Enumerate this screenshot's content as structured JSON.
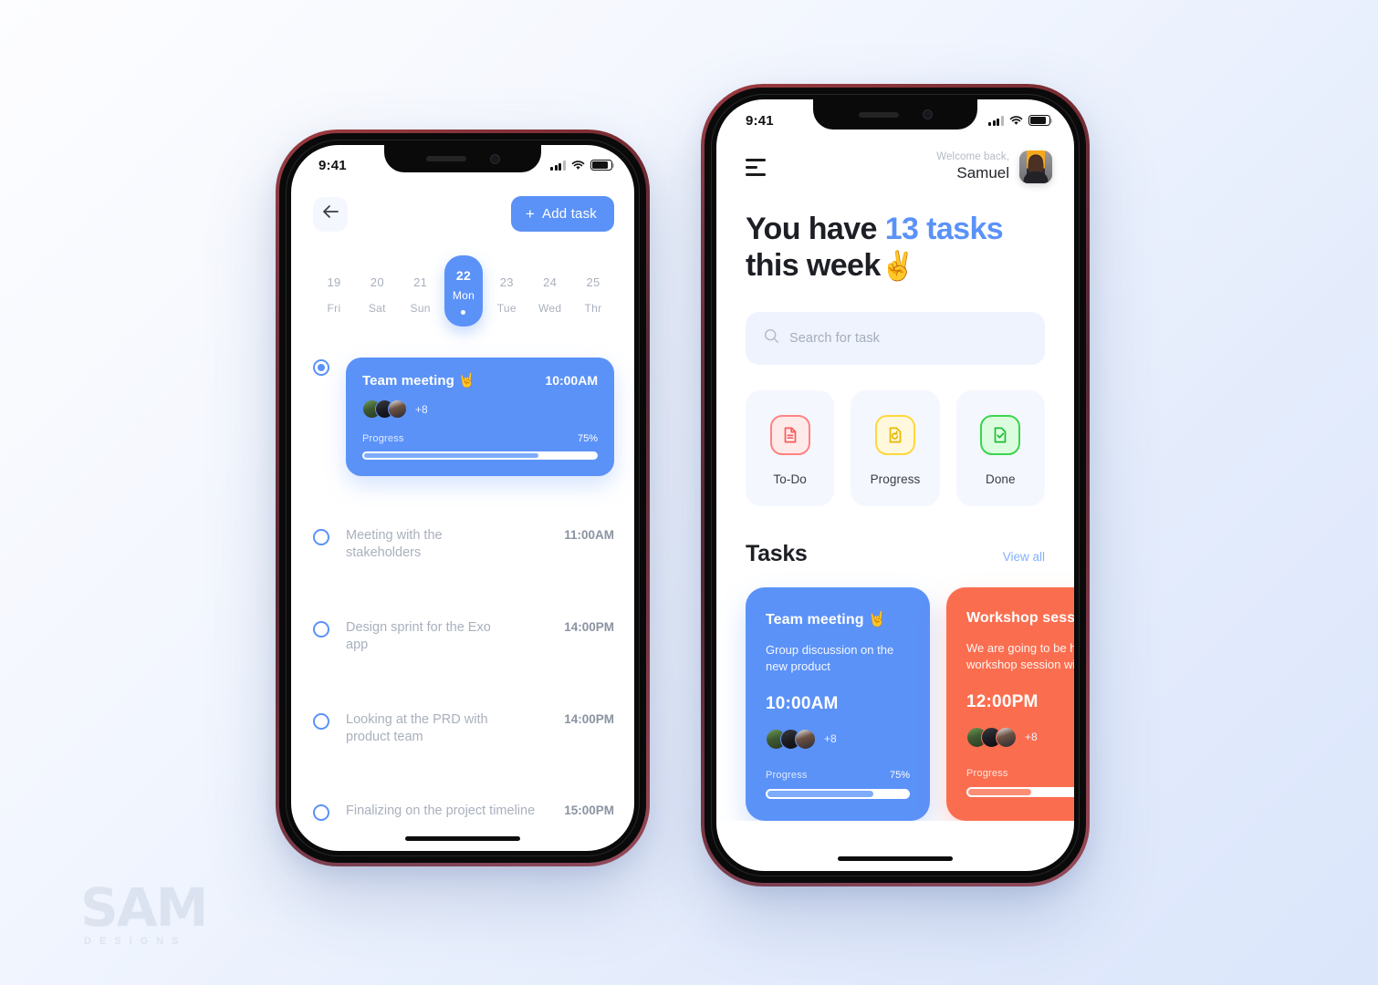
{
  "theme": {
    "accent_blue": "#5b92f8",
    "accent_orange": "#fa6e4f",
    "red": "#ff8282",
    "yellow": "#ffd83d",
    "green": "#3ad64b",
    "muted_text": "#a9b0bd",
    "dark_text": "#1d1f25"
  },
  "watermark": {
    "main": "SAM",
    "sub": "DESIGNS"
  },
  "phone_left": {
    "status_bar": {
      "time": "9:41",
      "signal_icon": "signal-bars-icon",
      "wifi_icon": "wifi-icon",
      "battery_icon": "battery-icon"
    },
    "topbar": {
      "back_icon": "arrow-left-icon",
      "add_task_label": "Add task",
      "add_task_plus": "+"
    },
    "dates": [
      {
        "num": "19",
        "dow": "Fri",
        "active": false
      },
      {
        "num": "20",
        "dow": "Sat",
        "active": false
      },
      {
        "num": "21",
        "dow": "Sun",
        "active": false
      },
      {
        "num": "22",
        "dow": "Mon",
        "active": true
      },
      {
        "num": "23",
        "dow": "Tue",
        "active": false
      },
      {
        "num": "24",
        "dow": "Wed",
        "active": false
      },
      {
        "num": "25",
        "dow": "Thr",
        "active": false
      }
    ],
    "featured_task": {
      "title": "Team meeting",
      "emoji": "🤘",
      "time": "10:00AM",
      "avatars_more": "+8",
      "progress_label": "Progress",
      "progress_pct": "75%",
      "progress_value": 75
    },
    "timeline_items": [
      {
        "title": "Meeting with the stakeholders",
        "time": "11:00AM"
      },
      {
        "title": "Design sprint for the Exo app",
        "time": "14:00PM"
      },
      {
        "title": "Looking at the PRD with product team",
        "time": "14:00PM"
      },
      {
        "title": "Finalizing on the project timeline",
        "time": "15:00PM"
      }
    ]
  },
  "phone_right": {
    "status_bar": {
      "time": "9:41",
      "signal_icon": "signal-bars-icon",
      "wifi_icon": "wifi-icon",
      "battery_icon": "battery-icon"
    },
    "topbar": {
      "menu_icon": "hamburger-menu-icon",
      "welcome_small": "Welcome back,",
      "user_name": "Samuel",
      "avatar_icon": "user-avatar"
    },
    "headline": {
      "part1": "You have ",
      "accent": "13 tasks",
      "part2": "this week",
      "emoji": "✌️"
    },
    "search": {
      "placeholder": "Search for task",
      "icon": "search-icon"
    },
    "categories": [
      {
        "label": "To-Do",
        "icon": "document-lines-icon",
        "color": "red"
      },
      {
        "label": "Progress",
        "icon": "document-refresh-icon",
        "color": "yellow"
      },
      {
        "label": "Done",
        "icon": "document-check-icon",
        "color": "green"
      }
    ],
    "tasks_section": {
      "title": "Tasks",
      "view_all": "View all"
    },
    "task_cards": [
      {
        "title": "Team meeting",
        "emoji": "🤘",
        "description": "Group discussion on the new product",
        "time": "10:00AM",
        "avatars_more": "+8",
        "progress_label": "Progress",
        "progress_pct": "75%",
        "progress_value": 75,
        "color": "blue"
      },
      {
        "title": "Workshop session",
        "emoji": "",
        "description": "We are going to be have a workshop session with",
        "time": "12:00PM",
        "avatars_more": "+8",
        "progress_label": "Progress",
        "progress_pct": "",
        "progress_value": 45,
        "color": "orange"
      }
    ]
  }
}
